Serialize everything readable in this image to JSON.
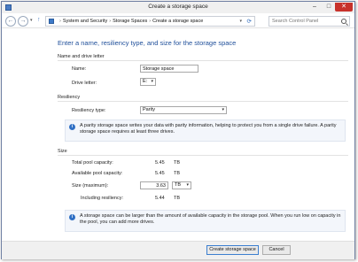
{
  "window": {
    "title": "Create a storage space"
  },
  "titlebar": {
    "minimize": "–",
    "maximize": "□",
    "close": "✕"
  },
  "nav": {
    "back": "←",
    "forward": "→",
    "breadcrumbs": [
      "System and Security",
      "Storage Spaces",
      "Create a storage space"
    ],
    "separator": "›",
    "search_placeholder": "Search Control Panel"
  },
  "page": {
    "heading": "Enter a name, resiliency type, and size for the storage space"
  },
  "name_drive": {
    "section_title": "Name and drive letter",
    "name_label": "Name:",
    "name_value": "Storage space",
    "drive_label": "Drive letter:",
    "drive_value": "E:"
  },
  "resiliency": {
    "section_title": "Resiliency",
    "type_label": "Resiliency type:",
    "type_value": "Parity",
    "info": "A parity storage space writes your data with parity information, helping to protect you from a single drive failure. A parity storage space requires at least three drives."
  },
  "size": {
    "section_title": "Size",
    "total_label": "Total pool capacity:",
    "total_value": "5.45",
    "total_unit": "TB",
    "available_label": "Available pool capacity:",
    "available_value": "5.45",
    "available_unit": "TB",
    "max_label": "Size (maximum):",
    "max_value": "3.63",
    "max_unit": "TB",
    "incl_label": "Including resiliency:",
    "incl_value": "5.44",
    "incl_unit": "TB",
    "info": "A storage space can be larger than the amount of available capacity in the storage pool. When you run low on capacity in the pool, you can add more drives."
  },
  "footer": {
    "create_label": "Create storage space",
    "cancel_label": "Cancel"
  }
}
